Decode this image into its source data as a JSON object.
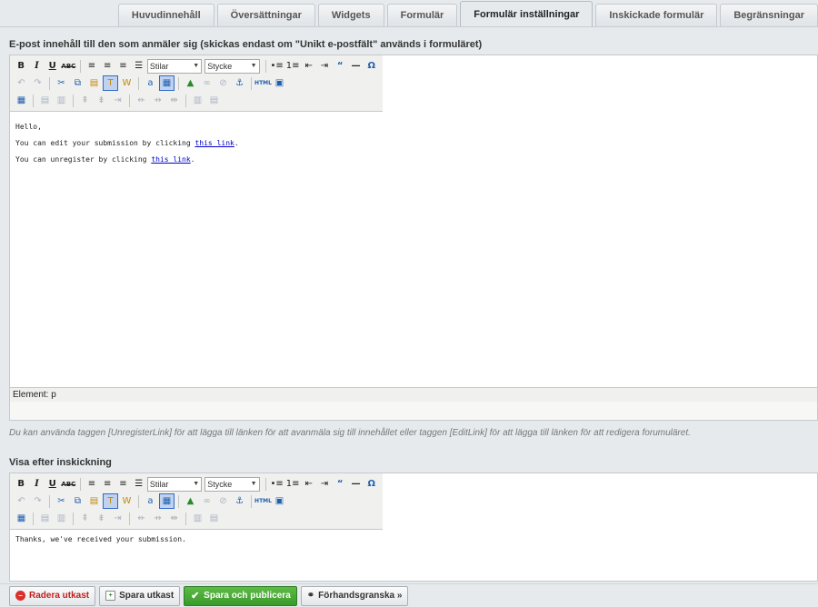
{
  "tabs": [
    "Huvudinnehåll",
    "Översättningar",
    "Widgets",
    "Formulär",
    "Formulär inställningar",
    "Inskickade formulär",
    "Begränsningar"
  ],
  "active_tab_index": 4,
  "email_section": {
    "label": "E-post innehåll till den som anmäler sig (skickas endast om \"Unikt e-postfält\" används i formuläret)",
    "style_select": "Stilar",
    "format_select": "Stycke",
    "content": {
      "greeting": "Hello,",
      "line1_prefix": "You can edit your submission by clicking ",
      "line1_link": "this link",
      "line1_suffix": ".",
      "line2_prefix": "You can unregister by clicking ",
      "line2_link": "this link",
      "line2_suffix": "."
    },
    "status_path": "Element: p",
    "hint": "Du kan använda taggen [UnregisterLink] för att lägga till länken för att avanmäla sig till innehållet eller taggen [EditLink] för att lägga till länken för att redigera forumuläret."
  },
  "after_section": {
    "label": "Visa efter inskickning",
    "style_select": "Stilar",
    "format_select": "Stycke",
    "content": "Thanks, we've received your submission."
  },
  "toolbar_icons": {
    "bold": "B",
    "italic": "I",
    "underline": "U",
    "strike": "ABC",
    "omega": "Ω",
    "html": "HTML"
  },
  "actions": {
    "delete_draft": "Radera utkast",
    "save_draft": "Spara utkast",
    "save_publish": "Spara och publicera",
    "preview": "Förhandsgranska »"
  }
}
